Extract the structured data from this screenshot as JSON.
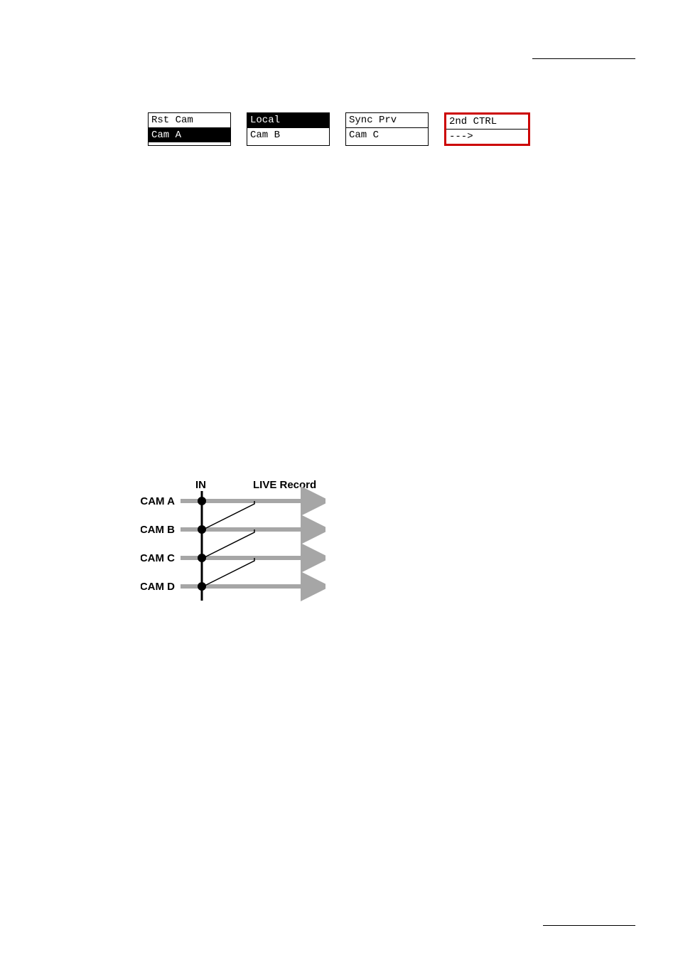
{
  "buttons": {
    "b1_top": "Rst Cam",
    "b1_bot": "Cam A",
    "b2_top": "Local",
    "b2_bot": "Cam B",
    "b3_top": "Sync Prv",
    "b3_bot": "Cam C",
    "b4_top": "2nd CTRL",
    "b4_bot": "--->"
  },
  "diagram": {
    "in": "IN",
    "live": "LIVE Record",
    "camA": "CAM A",
    "camB": "CAM B",
    "camC": "CAM C",
    "camD": "CAM D"
  }
}
